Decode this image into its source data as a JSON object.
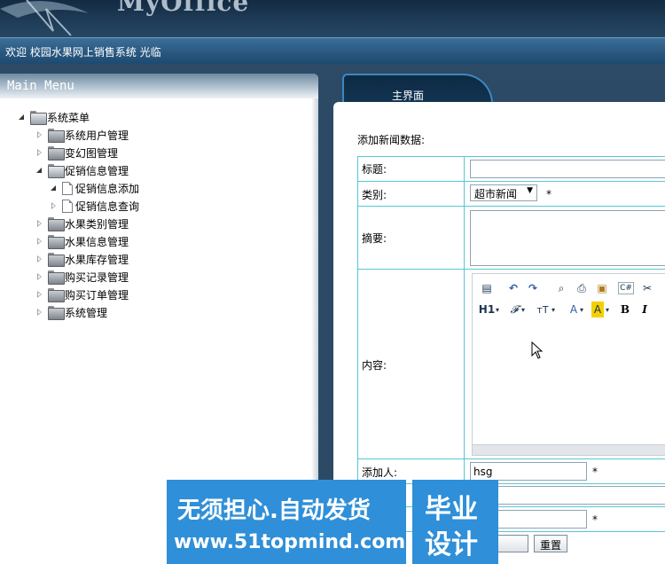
{
  "header": {
    "logo_text": "MyOffice"
  },
  "welcome": {
    "text": "欢迎 校园水果网上销售系统 光临"
  },
  "menu": {
    "title": "Main Menu",
    "items": [
      {
        "label": "系统菜单",
        "level": 0,
        "expanded": true,
        "icon": "folder-open-icon"
      },
      {
        "label": "系统用户管理",
        "level": 1,
        "expanded": false,
        "icon": "folder-icon"
      },
      {
        "label": "变幻图管理",
        "level": 1,
        "expanded": false,
        "icon": "folder-icon"
      },
      {
        "label": "促销信息管理",
        "level": 1,
        "expanded": true,
        "icon": "folder-open-icon"
      },
      {
        "label": "促销信息添加",
        "level": 2,
        "expanded": true,
        "icon": "file-icon"
      },
      {
        "label": "促销信息查询",
        "level": 2,
        "expanded": false,
        "icon": "file-icon"
      },
      {
        "label": "水果类别管理",
        "level": 1,
        "expanded": false,
        "icon": "folder-icon"
      },
      {
        "label": "水果信息管理",
        "level": 1,
        "expanded": false,
        "icon": "folder-icon"
      },
      {
        "label": "水果库存管理",
        "level": 1,
        "expanded": false,
        "icon": "folder-icon"
      },
      {
        "label": "购买记录管理",
        "level": 1,
        "expanded": false,
        "icon": "folder-icon"
      },
      {
        "label": "购买订单管理",
        "level": 1,
        "expanded": false,
        "icon": "folder-icon"
      },
      {
        "label": "系统管理",
        "level": 1,
        "expanded": false,
        "icon": "folder-icon"
      }
    ]
  },
  "tab": {
    "label": "主界面"
  },
  "form": {
    "title": "添加新闻数据:",
    "fields": {
      "title_label": "标题:",
      "title_value": "",
      "category_label": "类别:",
      "category_value": "超市新闻",
      "category_required": "*",
      "summary_label": "摘要:",
      "summary_value": "",
      "content_label": "内容:",
      "adder_label": "添加人:",
      "adder_value": "hsg",
      "adder_required": "*",
      "extra_required": "*"
    },
    "editor_toolbar": {
      "row1": [
        "paste-icon",
        "undo-icon",
        "redo-icon",
        "preview-icon",
        "print-icon",
        "template-icon",
        "code-icon",
        "cut-icon"
      ],
      "row2": [
        {
          "icon": "heading-icon",
          "text": "H1"
        },
        {
          "icon": "font-family-icon",
          "text": "𝓕"
        },
        {
          "icon": "font-size-icon",
          "text": "тT"
        },
        {
          "icon": "text-color-icon",
          "text": "A"
        },
        {
          "icon": "highlight-icon",
          "text": "A"
        },
        {
          "icon": "bold-icon",
          "text": "B"
        },
        {
          "icon": "italic-icon",
          "text": "I"
        }
      ]
    },
    "reset_label": "重置"
  },
  "watermark": {
    "line1": "无须担心.自动发货",
    "line2": "www.51topmind.com",
    "right1": "毕业",
    "right2": "设计"
  }
}
